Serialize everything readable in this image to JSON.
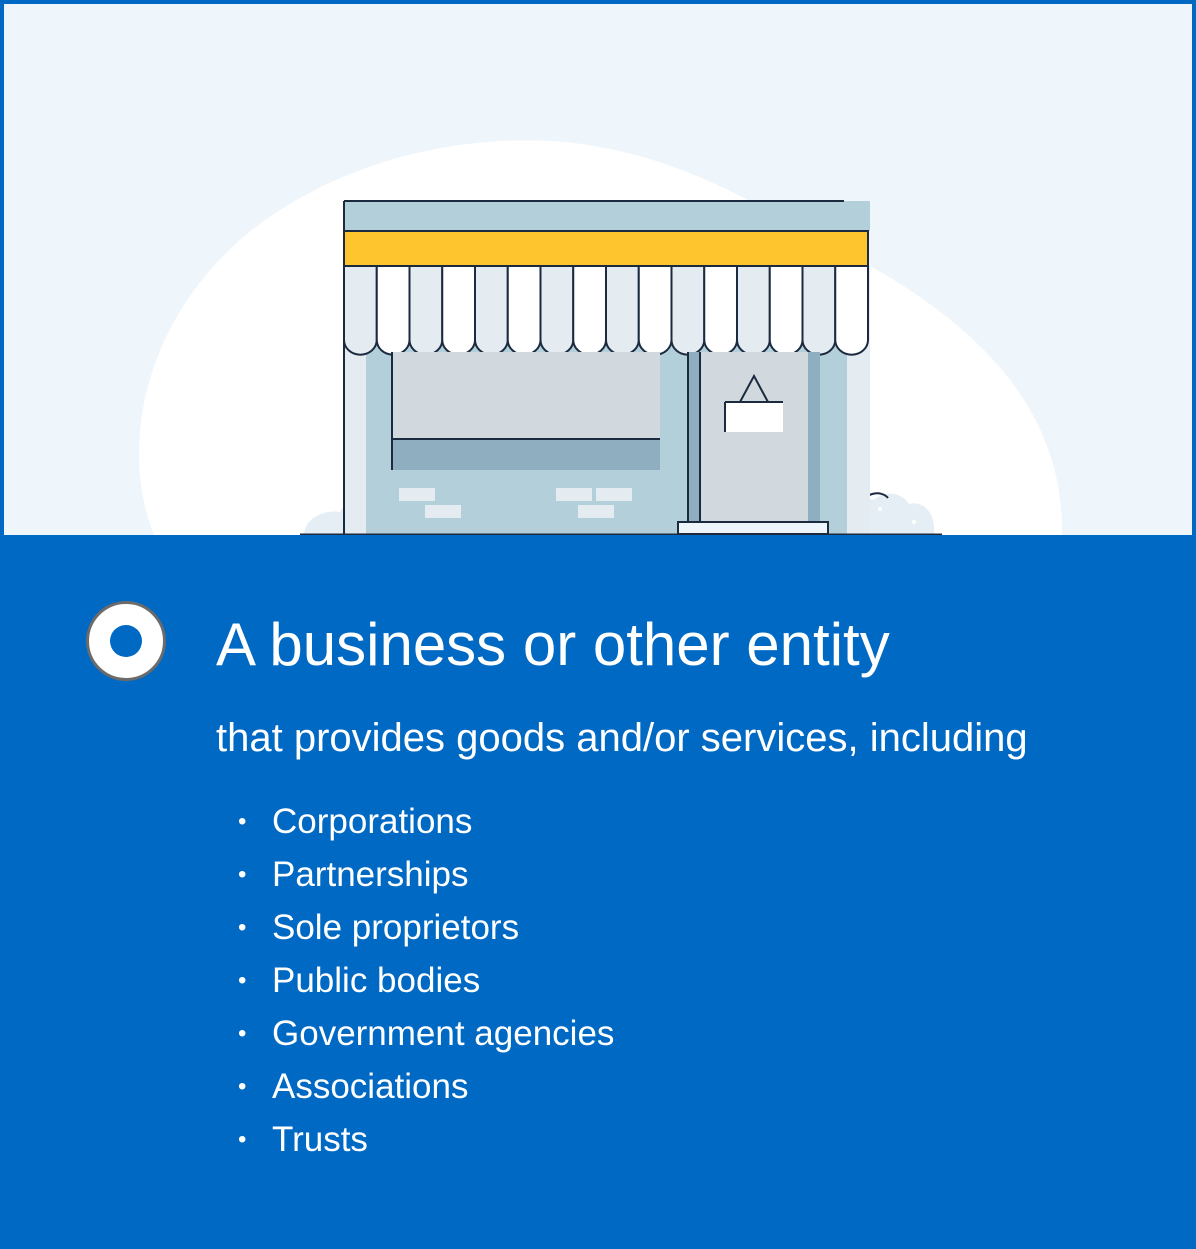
{
  "illustration": {
    "icon": "storefront-illustration",
    "colors": {
      "background": "#eef6fc",
      "blob": "#ffffff",
      "awning_band": "#ffc52f",
      "wall": "#b3cfd9",
      "outline": "#1c2a40"
    }
  },
  "heading": {
    "title": "A business or other entity",
    "subtitle": "that provides goods and/or services, including"
  },
  "list": {
    "bullet": "•",
    "items": [
      "Corporations",
      "Partnerships",
      "Sole proprietors",
      "Public bodies",
      "Government agencies",
      "Associations",
      "Trusts"
    ]
  },
  "colors": {
    "accent": "#0069c4",
    "text": "#ffffff"
  }
}
